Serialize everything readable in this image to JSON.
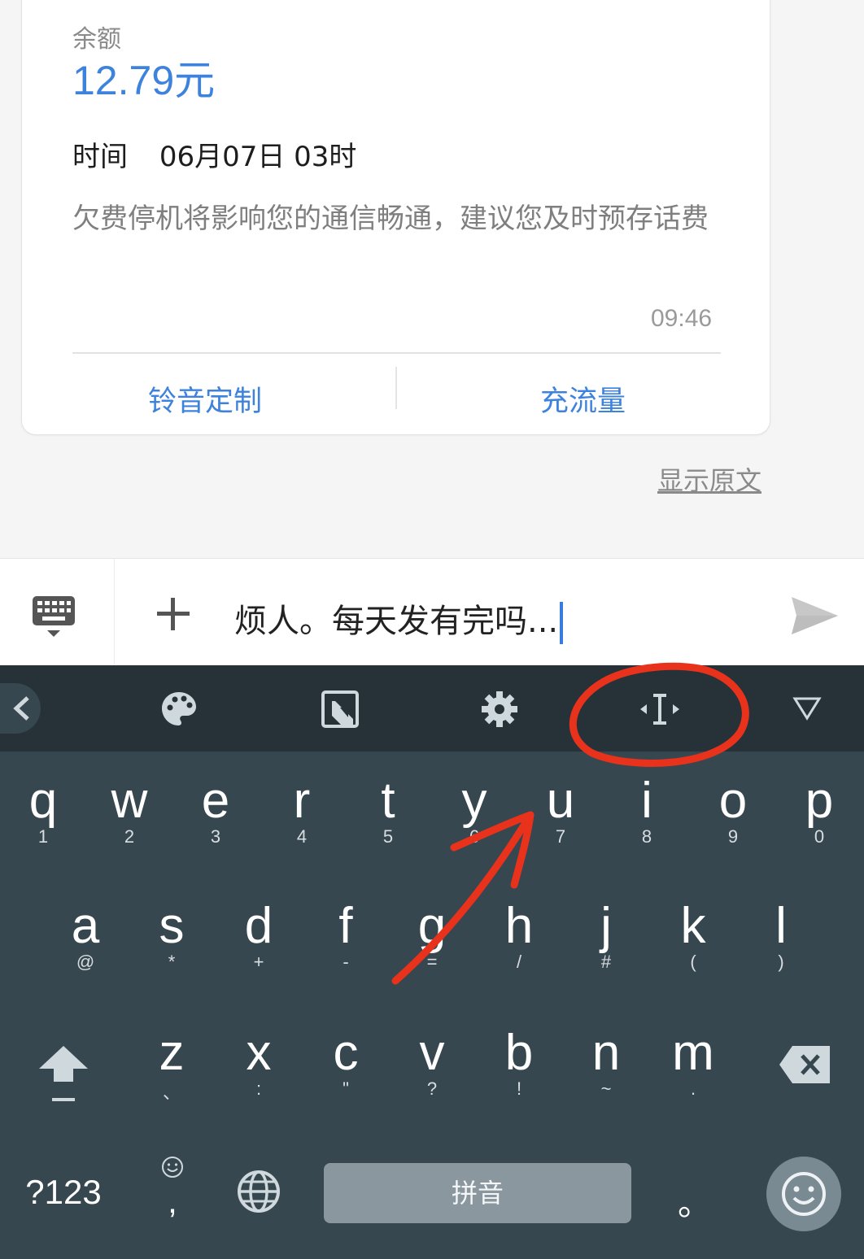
{
  "message_card": {
    "balance_label": "余额",
    "balance_amount": "12.79元",
    "time_label": "时间",
    "time_value": "06月07日 03时",
    "notice": "欠费停机将影响您的通信畅通，建议您及时预存话费",
    "timestamp": "09:46",
    "actions": [
      {
        "label": "铃音定制"
      },
      {
        "label": "充流量"
      }
    ],
    "show_original": "显示原文"
  },
  "compose": {
    "input_value": "烦人。每天发有完吗..."
  },
  "keyboard": {
    "toolbar_icons": [
      "collapse-left-icon",
      "palette-icon",
      "one-handed-mode-icon",
      "settings-icon",
      "text-cursor-navigation-icon",
      "hide-keyboard-icon"
    ],
    "rows": [
      [
        {
          "key": "q",
          "hint": "1"
        },
        {
          "key": "w",
          "hint": "2"
        },
        {
          "key": "e",
          "hint": "3"
        },
        {
          "key": "r",
          "hint": "4"
        },
        {
          "key": "t",
          "hint": "5"
        },
        {
          "key": "y",
          "hint": "6"
        },
        {
          "key": "u",
          "hint": "7"
        },
        {
          "key": "i",
          "hint": "8"
        },
        {
          "key": "o",
          "hint": "9"
        },
        {
          "key": "p",
          "hint": "0"
        }
      ],
      [
        {
          "key": "a",
          "hint": "@"
        },
        {
          "key": "s",
          "hint": "*"
        },
        {
          "key": "d",
          "hint": "+"
        },
        {
          "key": "f",
          "hint": "-"
        },
        {
          "key": "g",
          "hint": "="
        },
        {
          "key": "h",
          "hint": "/"
        },
        {
          "key": "j",
          "hint": "#"
        },
        {
          "key": "k",
          "hint": "("
        },
        {
          "key": "l",
          "hint": ")"
        }
      ],
      [
        {
          "key": "z",
          "hint": "、"
        },
        {
          "key": "x",
          "hint": ":"
        },
        {
          "key": "c",
          "hint": "\""
        },
        {
          "key": "v",
          "hint": "?"
        },
        {
          "key": "b",
          "hint": "!"
        },
        {
          "key": "n",
          "hint": "~"
        },
        {
          "key": "m",
          "hint": "."
        }
      ]
    ],
    "symbols_key": "?123",
    "comma_key": ",",
    "space_key": "拼音",
    "period_key": "。"
  },
  "colors": {
    "accent_blue": "#3d82dd",
    "keyboard_bg": "#37474f",
    "toolbar_bg": "#263238",
    "annotation_red": "#e8321c"
  }
}
